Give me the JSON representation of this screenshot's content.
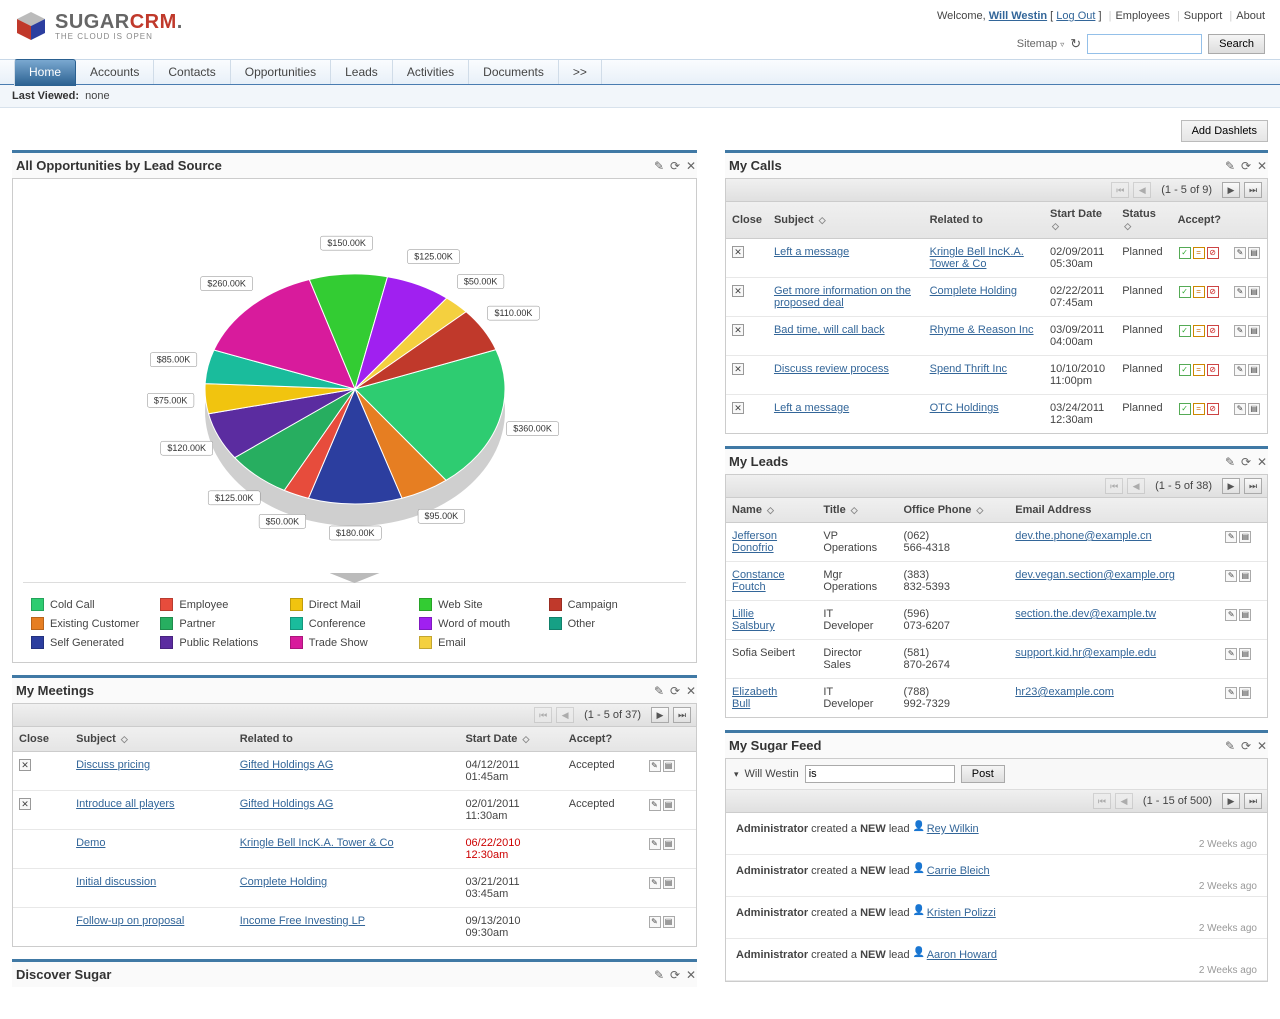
{
  "header": {
    "welcome": "Welcome,",
    "username": "Will Westin",
    "logout": "Log Out",
    "links": [
      "Employees",
      "Support",
      "About"
    ],
    "sitemap": "Sitemap",
    "search_btn": "Search",
    "logo_sugar": "SUGAR",
    "logo_crm": "CRM",
    "logo_tag": "THE CLOUD IS OPEN"
  },
  "nav": {
    "tabs": [
      "Home",
      "Accounts",
      "Contacts",
      "Opportunities",
      "Leads",
      "Activities",
      "Documents",
      ">>"
    ],
    "active": 0
  },
  "last_viewed": {
    "label": "Last Viewed:",
    "value": "none"
  },
  "buttons": {
    "add_dashlets": "Add Dashlets"
  },
  "chart_data": {
    "type": "pie",
    "title": "All Opportunities by Lead Source",
    "series": [
      {
        "name": "Cold Call",
        "value": 360000,
        "label": "$360.00K",
        "color": "#2ecc71"
      },
      {
        "name": "Existing Customer",
        "value": 95000,
        "label": "$95.00K",
        "color": "#e67e22"
      },
      {
        "name": "Self Generated",
        "value": 180000,
        "label": "$180.00K",
        "color": "#2c3e9f"
      },
      {
        "name": "Employee",
        "value": 50000,
        "label": "$50.00K",
        "color": "#e74c3c"
      },
      {
        "name": "Partner",
        "value": 125000,
        "label": "$125.00K",
        "color": "#27ae60"
      },
      {
        "name": "Public Relations",
        "value": 120000,
        "label": "$120.00K",
        "color": "#5b2ca0"
      },
      {
        "name": "Direct Mail",
        "value": 75000,
        "label": "$75.00K",
        "color": "#f1c40f"
      },
      {
        "name": "Conference",
        "value": 85000,
        "label": "$85.00K",
        "color": "#1abc9c"
      },
      {
        "name": "Trade Show",
        "value": 260000,
        "label": "$260.00K",
        "color": "#d81b9c"
      },
      {
        "name": "Web Site",
        "value": 150000,
        "label": "$150.00K",
        "color": "#33cc33"
      },
      {
        "name": "Word of mouth",
        "value": 125000,
        "label": "$125.00K",
        "color": "#a020f0"
      },
      {
        "name": "Email",
        "value": 50000,
        "label": "$50.00K",
        "color": "#f4d03f"
      },
      {
        "name": "Campaign",
        "value": 110000,
        "label": "$110.00K",
        "color": "#c0392b"
      },
      {
        "name": "Other",
        "value": 0,
        "label": "",
        "color": "#16a085"
      }
    ],
    "legend_rows": [
      [
        "Cold Call",
        "Employee",
        "Direct Mail",
        "Web Site",
        "Campaign"
      ],
      [
        "Existing Customer",
        "Partner",
        "Conference",
        "Word of mouth",
        "Other"
      ],
      [
        "Self Generated",
        "Public Relations",
        "Trade Show",
        "Email",
        ""
      ]
    ]
  },
  "meetings": {
    "title": "My Meetings",
    "pager": "(1 - 5 of 37)",
    "headers": [
      "Close",
      "Subject",
      "Related to",
      "Start Date",
      "Accept?"
    ],
    "rows": [
      {
        "close": true,
        "subject": "Discuss pricing",
        "related": "Gifted Holdings AG",
        "date": "04/12/2011 01:45am",
        "accept": "Accepted"
      },
      {
        "close": true,
        "subject": "Introduce all players",
        "related": "Gifted Holdings AG",
        "date": "02/01/2011 11:30am",
        "accept": "Accepted"
      },
      {
        "close": false,
        "subject": "Demo",
        "related": "Kringle Bell IncK.A. Tower & Co",
        "date": "06/22/2010 12:30am",
        "accept": "",
        "red": true
      },
      {
        "close": false,
        "subject": "Initial discussion",
        "related": "Complete Holding",
        "date": "03/21/2011 03:45am",
        "accept": ""
      },
      {
        "close": false,
        "subject": "Follow-up on proposal",
        "related": "Income Free Investing LP",
        "date": "09/13/2010 09:30am",
        "accept": ""
      }
    ]
  },
  "discover": {
    "title": "Discover Sugar"
  },
  "calls": {
    "title": "My Calls",
    "pager": "(1 - 5 of 9)",
    "headers": [
      "Close",
      "Subject",
      "Related to",
      "Start Date",
      "Status",
      "Accept?"
    ],
    "rows": [
      {
        "subject": "Left a message",
        "related": "Kringle Bell IncK.A. Tower & Co",
        "date": "02/09/2011 05:30am",
        "status": "Planned"
      },
      {
        "subject": "Get more information on the proposed deal",
        "related": "Complete Holding",
        "date": "02/22/2011 07:45am",
        "status": "Planned"
      },
      {
        "subject": "Bad time, will call back",
        "related": "Rhyme & Reason Inc",
        "date": "03/09/2011 04:00am",
        "status": "Planned"
      },
      {
        "subject": "Discuss review process",
        "related": "Spend Thrift Inc",
        "date": "10/10/2010 11:00pm",
        "status": "Planned"
      },
      {
        "subject": "Left a message",
        "related": "OTC Holdings",
        "date": "03/24/2011 12:30am",
        "status": "Planned"
      }
    ]
  },
  "leads": {
    "title": "My Leads",
    "pager": "(1 - 5 of 38)",
    "headers": [
      "Name",
      "Title",
      "Office Phone",
      "Email Address"
    ],
    "rows": [
      {
        "name": "Jefferson Donofrio",
        "title": "VP Operations",
        "phone": "(062) 566-4318",
        "email": "dev.the.phone@example.cn"
      },
      {
        "name": "Constance Foutch",
        "title": "Mgr Operations",
        "phone": "(383) 832-5393",
        "email": "dev.vegan.section@example.org"
      },
      {
        "name": "Lillie Salsbury",
        "title": "IT Developer",
        "phone": "(596) 073-6207",
        "email": "section.the.dev@example.tw"
      },
      {
        "name": "Sofia Seibert",
        "title": "Director Sales",
        "phone": "(581) 870-2674",
        "email": "support.kid.hr@example.edu",
        "nolink": true
      },
      {
        "name": "Elizabeth Bull",
        "title": "IT Developer",
        "phone": "(788) 992-7329",
        "email": "hr23@example.com"
      }
    ]
  },
  "feed": {
    "title": "My Sugar Feed",
    "user": "Will Westin",
    "input_val": "is",
    "post": "Post",
    "pager": "(1 - 15 of 500)",
    "items": [
      {
        "who": "Administrator",
        "action": " created a ",
        "bold": "NEW",
        "what": " lead ",
        "target": "Rey Wilkin",
        "time": "2 Weeks ago"
      },
      {
        "who": "Administrator",
        "action": " created a ",
        "bold": "NEW",
        "what": " lead ",
        "target": "Carrie Bleich",
        "time": "2 Weeks ago"
      },
      {
        "who": "Administrator",
        "action": " created a ",
        "bold": "NEW",
        "what": " lead ",
        "target": "Kristen Polizzi",
        "time": "2 Weeks ago"
      },
      {
        "who": "Administrator",
        "action": " created a ",
        "bold": "NEW",
        "what": " lead ",
        "target": "Aaron Howard",
        "time": "2 Weeks ago"
      }
    ]
  }
}
